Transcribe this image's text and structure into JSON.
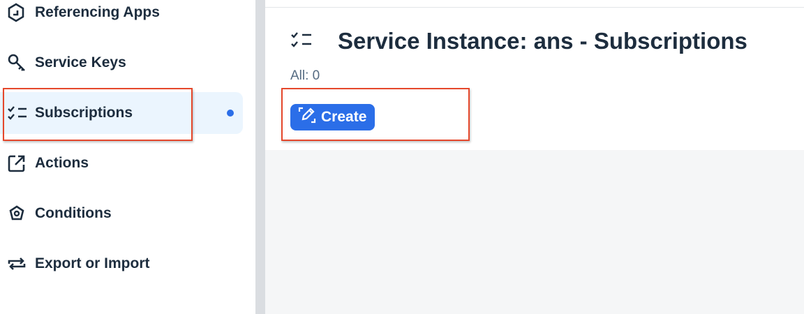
{
  "sidebar": {
    "items": [
      {
        "label": "Referencing Apps",
        "icon": "hexagon-app-icon"
      },
      {
        "label": "Service Keys",
        "icon": "key-icon"
      },
      {
        "label": "Subscriptions",
        "icon": "checklist-icon",
        "selected": true
      },
      {
        "label": "Actions",
        "icon": "share-icon"
      },
      {
        "label": "Conditions",
        "icon": "condition-icon"
      },
      {
        "label": "Export or Import",
        "icon": "sync-icon"
      }
    ]
  },
  "main": {
    "title": "Service Instance: ans - Subscriptions",
    "count": "All: 0",
    "create_label": "Create"
  },
  "colors": {
    "accent": "#2b6ee8",
    "highlight": "#e5472b",
    "selected_bg": "#ebf5fe"
  }
}
